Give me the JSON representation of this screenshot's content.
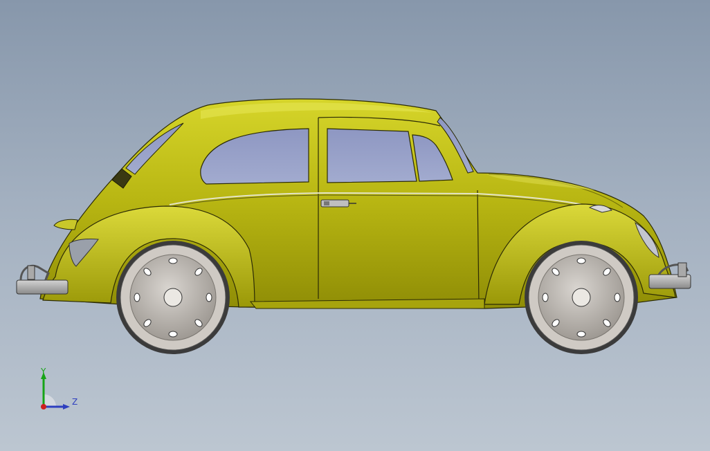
{
  "viewport": {
    "view": "right side view",
    "background_top": "#8797ab",
    "background_bottom": "#bcc6d1"
  },
  "model": {
    "name": "car-3d-model",
    "body_color": "#b5b311",
    "window_color": "#8e9ac0",
    "wheel_color": "#c9c4bf",
    "tire_color": "#3b3b3b"
  },
  "triad": {
    "y_label": "Y",
    "z_label": "Z",
    "y_color": "#17a417",
    "z_color": "#2e3fbf",
    "x_color": "#cc1f1f"
  }
}
